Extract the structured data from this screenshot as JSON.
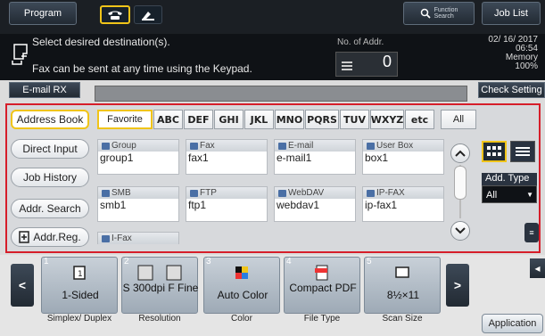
{
  "top_bar": {
    "program_label": "Program",
    "function_search_label_1": "Function",
    "function_search_label_2": "Search",
    "job_list_label": "Job List",
    "mode_icons": [
      "fax-icon",
      "scan-icon"
    ]
  },
  "status": {
    "message_1": "Select desired destination(s).",
    "message_2": "Fax can be sent at any time using the Keypad.",
    "no_of_addr_label": "No. of Addr.",
    "no_of_addr_value": "0",
    "date": "02/ 16/ 2017",
    "time": "06:54",
    "memory_label": "Memory",
    "memory_value": "100%"
  },
  "destination_bar": {
    "email_rx_label": "E-mail RX",
    "check_setting_label": "Check Setting"
  },
  "left_menu": {
    "address_book": "Address Book",
    "direct_input": "Direct Input",
    "job_history": "Job History",
    "addr_search": "Addr. Search",
    "addr_reg": "Addr.Reg."
  },
  "index_tabs": [
    "Favorite",
    "ABC",
    "DEF",
    "GHI",
    "JKL",
    "MNO",
    "PQRS",
    "TUV",
    "WXYZ",
    "etc",
    "All"
  ],
  "address_cards": [
    {
      "category": "Group",
      "name": "group1"
    },
    {
      "category": "Fax",
      "name": "fax1"
    },
    {
      "category": "E-mail",
      "name": "e-mail1"
    },
    {
      "category": "User Box",
      "name": "box1"
    },
    {
      "category": "SMB",
      "name": "smb1"
    },
    {
      "category": "FTP",
      "name": "ftp1"
    },
    {
      "category": "WebDAV",
      "name": "webdav1"
    },
    {
      "category": "IP-FAX",
      "name": "ip-fax1"
    },
    {
      "category": "I-Fax",
      "name": ""
    }
  ],
  "right_panel": {
    "add_type_label": "Add. Type",
    "add_type_value": "All"
  },
  "settings_tiles": [
    {
      "num": "1",
      "value": "1-Sided",
      "label": "Simplex/ Duplex"
    },
    {
      "num": "2",
      "value": "S 300dpi F Fine",
      "label": "Resolution"
    },
    {
      "num": "3",
      "value": "Auto Color",
      "label": "Color"
    },
    {
      "num": "4",
      "value": "Compact PDF",
      "label": "File Type"
    },
    {
      "num": "5",
      "value": "8½×11",
      "label": "Scan Size"
    }
  ],
  "application_label": "Application",
  "colors": {
    "accent_yellow": "#f0c419",
    "frame_red": "#d61e2a",
    "dark_bg": "#1b1f24"
  }
}
